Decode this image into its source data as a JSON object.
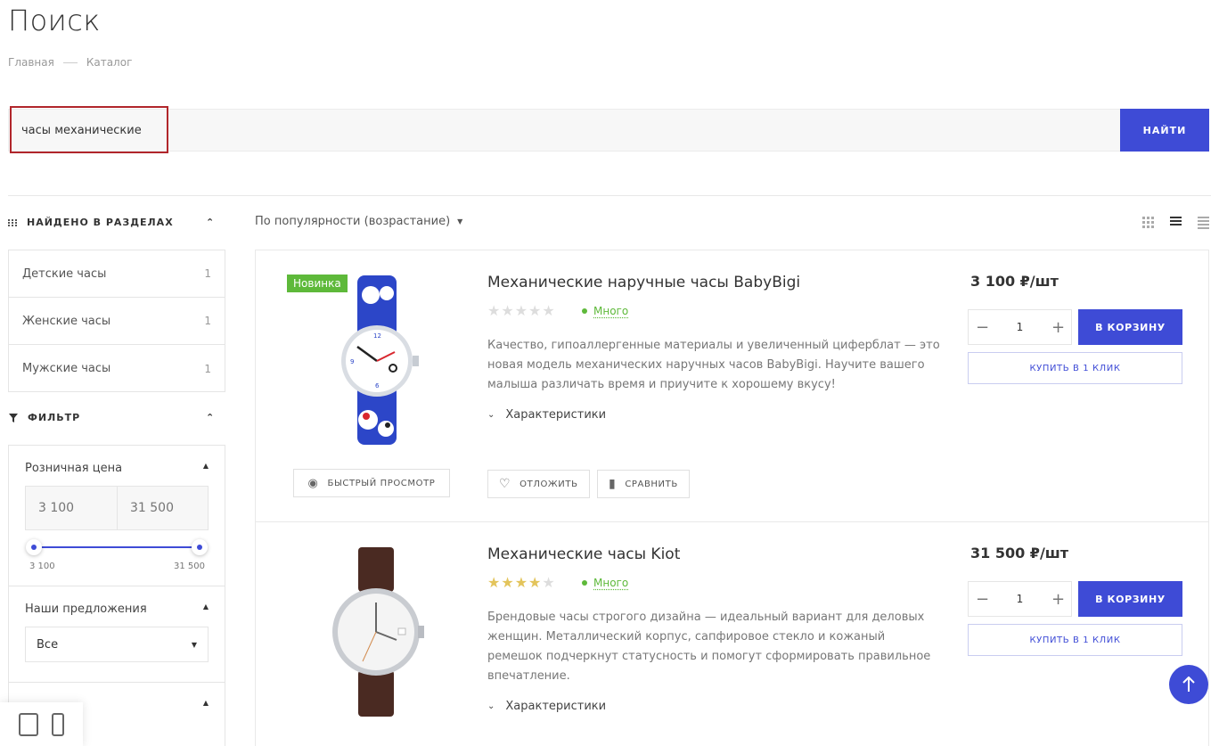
{
  "page": {
    "title": "Поиск"
  },
  "breadcrumb": [
    "Главная",
    "Каталог"
  ],
  "search": {
    "value": "часы механические",
    "button": "НАЙТИ"
  },
  "sidebar": {
    "sections_title": "НАЙДЕНО В РАЗДЕЛАХ",
    "sections": [
      {
        "label": "Детские часы",
        "count": "1"
      },
      {
        "label": "Женские часы",
        "count": "1"
      },
      {
        "label": "Мужские часы",
        "count": "1"
      }
    ],
    "filter_title": "ФИЛЬТР",
    "price": {
      "title": "Розничная цена",
      "min_placeholder": "3 100",
      "max_placeholder": "31 500",
      "min_label": "3 100",
      "max_label": "31 500"
    },
    "offers": {
      "title": "Наши предложения",
      "selected": "Все"
    }
  },
  "sort": {
    "label": "По популярности (возрастание)"
  },
  "products": [
    {
      "badge": "Новинка",
      "name": "Механические наручные часы BabyBigi",
      "rating": 0,
      "stock": "Много",
      "description": "Качество, гипоаллергенные материалы и увеличенный циферблат — это новая модель механических наручных часов BabyBigi. Научите вашего малыша различать время и приучите к хорошему вкусу!",
      "characteristics": "Характеристики",
      "quick_view": "БЫСТРЫЙ ПРОСМОТР",
      "defer": "ОТЛОЖИТЬ",
      "compare": "СРАВНИТЬ",
      "price": "3 100 ₽/шт",
      "qty": "1",
      "cart": "В КОРЗИНУ",
      "one_click": "КУПИТЬ В 1 КЛИК"
    },
    {
      "name": "Механические часы Kiot",
      "rating": 4,
      "stock": "Много",
      "description": "Брендовые часы строгого дизайна — идеальный вариант для деловых женщин. Металлический корпус, сапфировое стекло и кожаный ремешок подчеркнут статусность и помогут сформировать правильное впечатление.",
      "characteristics": "Характеристики",
      "price": "31 500 ₽/шт",
      "qty": "1",
      "cart": "В КОРЗИНУ",
      "one_click": "КУПИТЬ В 1 КЛИК"
    }
  ],
  "colors": {
    "accent": "#3e4bd6",
    "badge": "#5eb93a",
    "star": "#e3c45b",
    "highlight": "#b1262b"
  }
}
